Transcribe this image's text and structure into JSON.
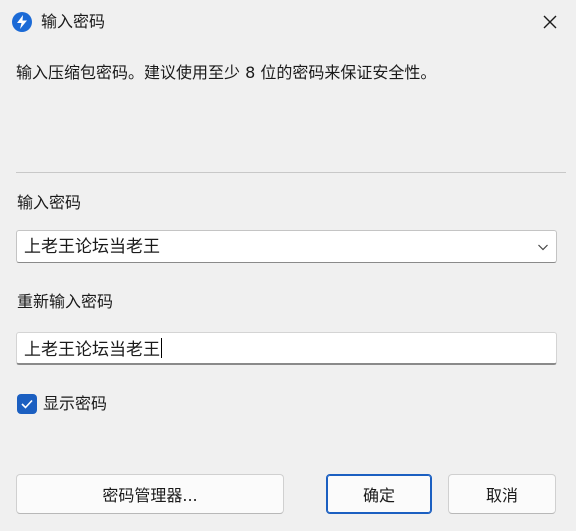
{
  "window": {
    "title": "输入密码",
    "app_icon": "lightning-icon",
    "close_icon": "close-icon"
  },
  "description": "输入压缩包密码。建议使用至少 8 位的密码来保证安全性。",
  "password": {
    "label": "输入密码",
    "value": "上老王论坛当老王"
  },
  "confirm_password": {
    "label": "重新输入密码",
    "value": "上老王论坛当老王"
  },
  "show_password": {
    "label": "显示密码",
    "checked": true
  },
  "buttons": {
    "manager": "密码管理器...",
    "ok": "确定",
    "cancel": "取消"
  },
  "colors": {
    "accent": "#1b5fc1",
    "background": "#f0f0f0"
  }
}
